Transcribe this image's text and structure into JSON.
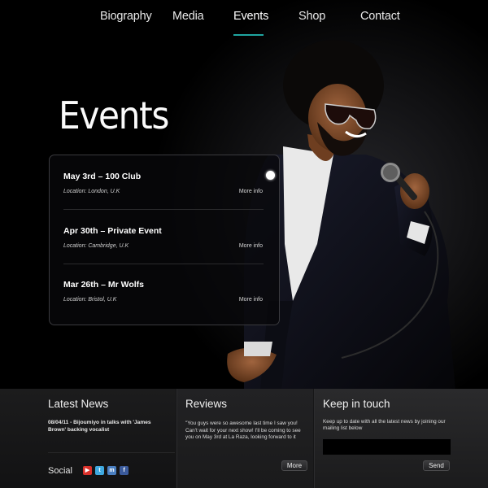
{
  "nav": {
    "items": [
      {
        "label": "Biography"
      },
      {
        "label": "Media"
      },
      {
        "label": "Events"
      },
      {
        "label": "Shop"
      },
      {
        "label": "Contact"
      }
    ],
    "active": "Events",
    "accent_color": "#1fa5a0"
  },
  "page_title": "Events",
  "events": [
    {
      "title": "May 3rd – 100 Club",
      "location": "Location: London, U.K",
      "more": "More info"
    },
    {
      "title": "Apr 30th – Private Event",
      "location": "Location: Cambridge, U.K",
      "more": "More info"
    },
    {
      "title": "Mar 26th – Mr Wolfs",
      "location": "Location: Bristol, U.K",
      "more": "More info"
    }
  ],
  "footer": {
    "news": {
      "heading": "Latest News",
      "item": "08/04/11 - Bijoumiyo in talks with 'James Brown' backing vocalist"
    },
    "social": {
      "label": "Social",
      "icons": [
        {
          "name": "youtube-icon",
          "glyph": "▶",
          "color": "#d9302a"
        },
        {
          "name": "twitter-icon",
          "glyph": "t",
          "color": "#3fa9e0"
        },
        {
          "name": "myspace-icon",
          "glyph": "m",
          "color": "#4a7fc1"
        },
        {
          "name": "facebook-icon",
          "glyph": "f",
          "color": "#3b5b9c"
        }
      ]
    },
    "reviews": {
      "heading": "Reviews",
      "text": "\"You guys were so awesome last time I saw you! Can't wait for your next show! I'll be coming to see you on May 3rd at La Raza, looking forward to it",
      "more": "More"
    },
    "touch": {
      "heading": "Keep in touch",
      "text": "Keep up to date with all the latest news by joining our mailing list below",
      "input_value": "",
      "send": "Send"
    }
  }
}
